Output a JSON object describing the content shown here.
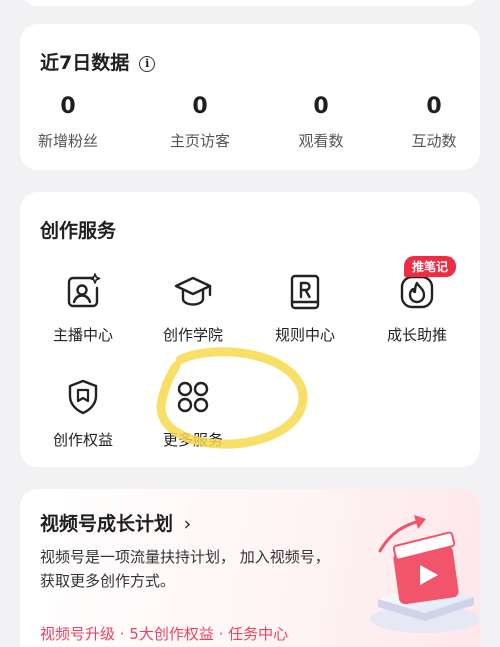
{
  "stats": {
    "title": "近7日数据",
    "items": [
      {
        "value": "0",
        "label": "新增粉丝"
      },
      {
        "value": "0",
        "label": "主页访客"
      },
      {
        "value": "0",
        "label": "观看数"
      },
      {
        "value": "0",
        "label": "互动数"
      }
    ]
  },
  "services": {
    "title": "创作服务",
    "items": [
      {
        "label": "主播中心",
        "icon": "anchor-profile-icon"
      },
      {
        "label": "创作学院",
        "icon": "graduation-cap-icon"
      },
      {
        "label": "规则中心",
        "icon": "rules-book-icon"
      },
      {
        "label": "成长助推",
        "icon": "flame-boost-icon",
        "badge": "推笔记"
      },
      {
        "label": "创作权益",
        "icon": "shield-icon"
      },
      {
        "label": "更多服务",
        "icon": "four-circles-icon"
      }
    ]
  },
  "growth": {
    "title": "视频号成长计划",
    "chevron": "›",
    "description": "视频号是一项流量扶持计划， 加入视频号，获取更多创作方式。",
    "links": "视频号升级 · 5大创作权益 · 任务中心"
  },
  "colors": {
    "accent": "#ee2d44",
    "link": "#e84560",
    "highlight": "#f7d94c"
  }
}
